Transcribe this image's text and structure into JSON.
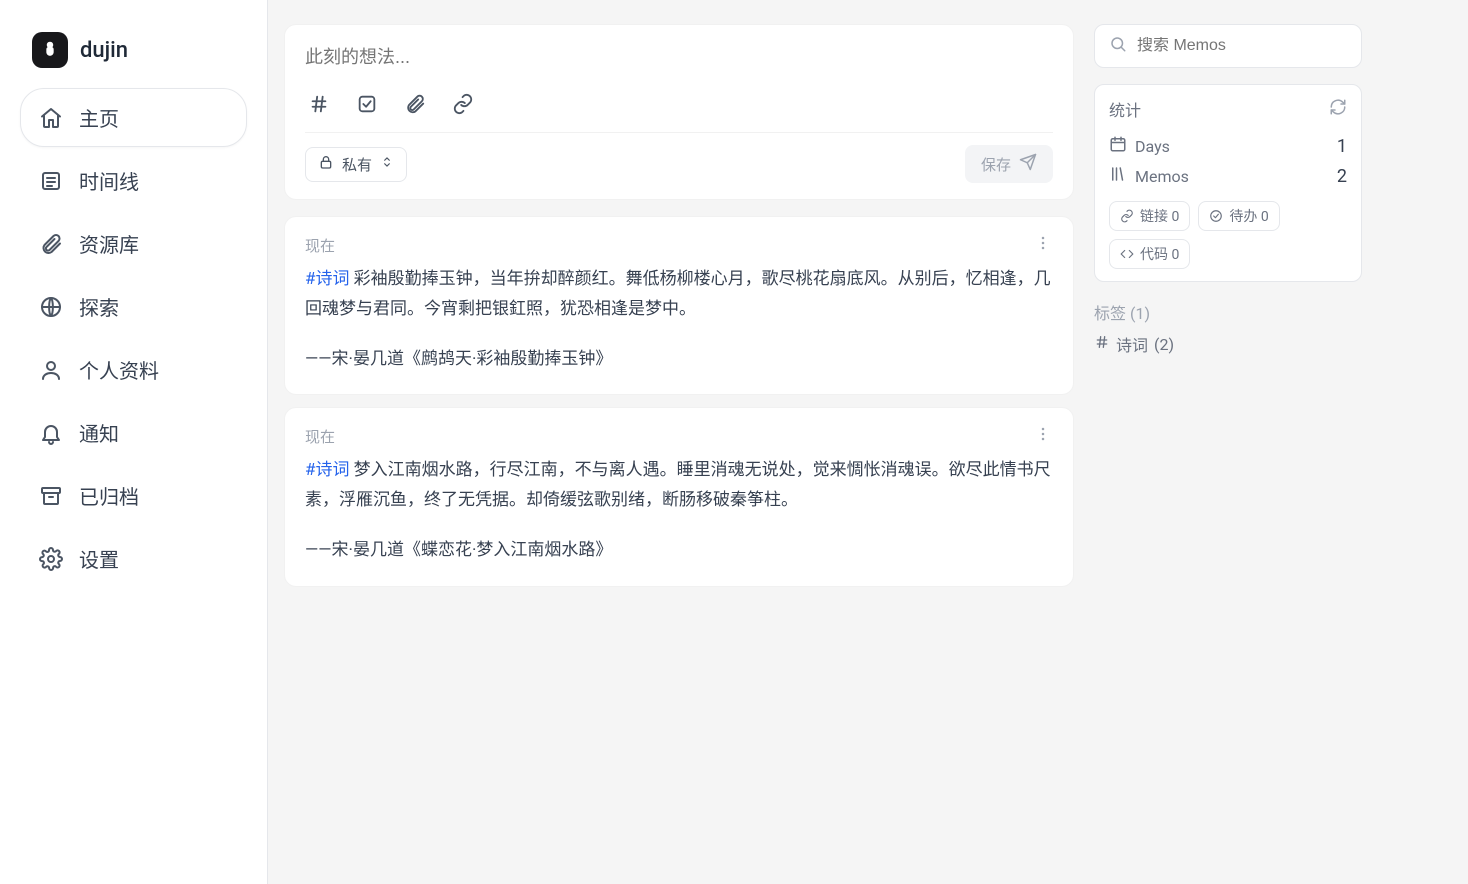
{
  "brand": {
    "name": "dujin"
  },
  "nav": {
    "items": [
      {
        "label": "主页",
        "icon": "home",
        "active": true
      },
      {
        "label": "时间线",
        "icon": "timeline",
        "active": false
      },
      {
        "label": "资源库",
        "icon": "paperclip",
        "active": false
      },
      {
        "label": "探索",
        "icon": "globe",
        "active": false
      },
      {
        "label": "个人资料",
        "icon": "user",
        "active": false
      },
      {
        "label": "通知",
        "icon": "bell",
        "active": false
      },
      {
        "label": "已归档",
        "icon": "archive",
        "active": false
      },
      {
        "label": "设置",
        "icon": "settings",
        "active": false
      }
    ]
  },
  "composer": {
    "placeholder": "此刻的想法...",
    "visibility": "私有",
    "save_label": "保存"
  },
  "memos": [
    {
      "time": "现在",
      "hashtag": "#诗词",
      "text": " 彩袖殷勤捧玉钟，当年拚却醉颜红。舞低杨柳楼心月，歌尽桃花扇底风。从别后，忆相逢，几回魂梦与君同。今宵剩把银釭照，犹恐相逢是梦中。",
      "source": "——宋·晏几道《鹧鸪天·彩袖殷勤捧玉钟》"
    },
    {
      "time": "现在",
      "hashtag": "#诗词",
      "text": " 梦入江南烟水路，行尽江南，不与离人遇。睡里消魂无说处，觉来惆怅消魂误。欲尽此情书尺素，浮雁沉鱼，终了无凭据。却倚缓弦歌别绪，断肠移破秦筝柱。",
      "source": "——宋·晏几道《蝶恋花·梦入江南烟水路》"
    }
  ],
  "search": {
    "placeholder": "搜索 Memos"
  },
  "stats": {
    "title": "统计",
    "days_label": "Days",
    "days_value": "1",
    "memos_label": "Memos",
    "memos_value": "2",
    "chips": {
      "links": "链接 0",
      "todos": "待办 0",
      "code": "代码 0"
    }
  },
  "tags": {
    "title": "标签 (1)",
    "items": [
      {
        "name": "诗词",
        "count": "(2)"
      }
    ]
  }
}
